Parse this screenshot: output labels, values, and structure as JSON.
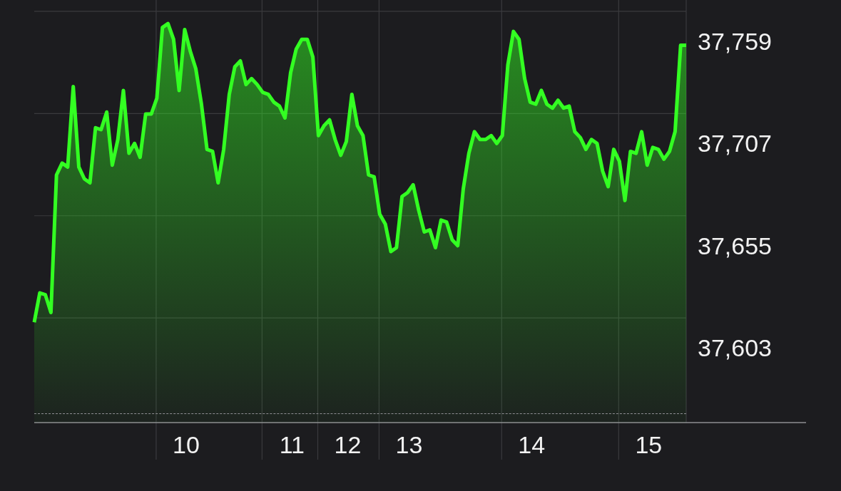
{
  "chart_data": {
    "type": "area",
    "categories": [
      null,
      null,
      null,
      null,
      null,
      null,
      null,
      null,
      null,
      null,
      null,
      null,
      null,
      null,
      null,
      null,
      null,
      null,
      null,
      null,
      null,
      null,
      null,
      null,
      null,
      null,
      null,
      "10",
      null,
      null,
      null,
      null,
      null,
      null,
      null,
      null,
      null,
      null,
      null,
      null,
      null,
      null,
      null,
      null,
      null,
      null,
      "11",
      null,
      null,
      null,
      null,
      null,
      null,
      null,
      null,
      null,
      "12",
      null,
      null,
      null,
      null,
      null,
      null,
      null,
      null,
      null,
      null,
      "13",
      null,
      null,
      null,
      null,
      null,
      null,
      null,
      null,
      null,
      null,
      null,
      null,
      null,
      null,
      null,
      null,
      null,
      null,
      null,
      null,
      null,
      "14",
      null,
      null,
      null,
      null,
      null,
      null,
      null,
      null,
      null,
      null,
      null,
      null,
      null,
      null,
      null,
      null,
      null,
      null,
      null,
      null,
      "15",
      null,
      null,
      null,
      null,
      null,
      null,
      null
    ],
    "series": [
      {
        "color": "#33ff22",
        "values": [
          37616,
          37631,
          37630,
          37621,
          37691,
          37697,
          37695,
          37736,
          37695,
          37689,
          37687,
          37715,
          37714,
          37723,
          37696,
          37709,
          37734,
          37702,
          37707,
          37700,
          37722,
          37722,
          37730,
          37766,
          37768,
          37760,
          37734,
          37765,
          37754,
          37745,
          37727,
          37704,
          37703,
          37687,
          37704,
          37732,
          37746,
          37749,
          37737,
          37740,
          37737,
          37733,
          37732,
          37728,
          37726,
          37720,
          37743,
          37755,
          37760,
          37760,
          37751,
          37711,
          37716,
          37719,
          37709,
          37701,
          37708,
          37732,
          37716,
          37711,
          37691,
          37690,
          37671,
          37666,
          37652,
          37654,
          37680,
          37682,
          37686,
          37673,
          37662,
          37663,
          37654,
          37668,
          37667,
          37658,
          37655,
          37684,
          37702,
          37713,
          37709,
          37709,
          37711,
          37707,
          37711,
          37747,
          37764,
          37760,
          37740,
          37728,
          37727,
          37734,
          37727,
          37725,
          37729,
          37725,
          37726,
          37713,
          37710,
          37704,
          37709,
          37707,
          37693,
          37685,
          37704,
          37698,
          37678,
          37703,
          37702,
          37713,
          37696,
          37705,
          37704,
          37699,
          37703,
          37713,
          37757,
          37757
        ]
      }
    ],
    "ylim": [
      37565,
      37780
    ],
    "yticks": [
      {
        "value": 37603,
        "label": "37,603"
      },
      {
        "value": 37655,
        "label": "37,655"
      },
      {
        "value": 37707,
        "label": "37,707"
      },
      {
        "value": 37759,
        "label": "37,759"
      }
    ]
  }
}
